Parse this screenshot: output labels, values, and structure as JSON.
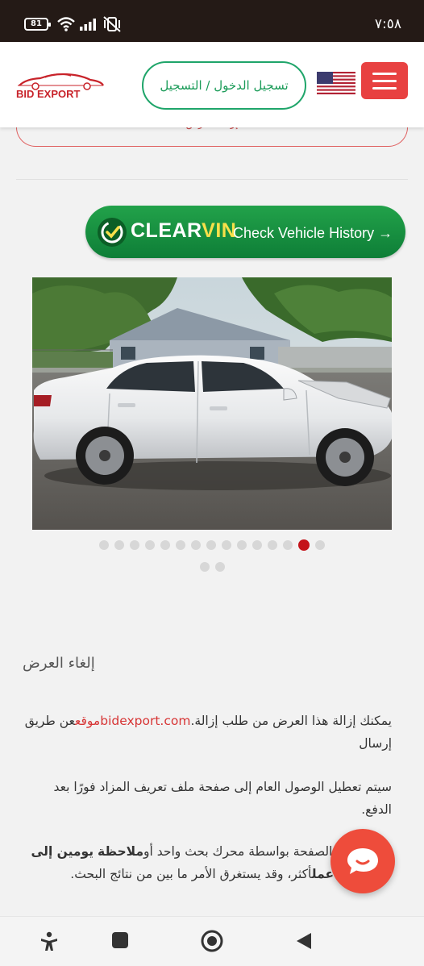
{
  "status_bar": {
    "battery": "81",
    "time": "٧:٥٨"
  },
  "header": {
    "logo_text": "BID EXPORT",
    "login_label": "تسجيل الدخول / التسجيل",
    "flag_icon": "us-flag-icon",
    "menu_icon": "hamburger-menu-icon",
    "accent_color": "#e84141",
    "login_color": "#1fa56a"
  },
  "remove_pill": {
    "label": "إزالة العرض"
  },
  "clearvin": {
    "brand_clear": "CLEAR",
    "brand_vin": "VIN",
    "cta": "Check Vehicle History →",
    "color": "#17913f"
  },
  "gallery": {
    "image_description": "white sedan parked on gravel lot",
    "total_dots": 16,
    "active_index": 13,
    "dot_color": "#d7d7d7",
    "active_color": "#c4141a"
  },
  "content": {
    "heading": "إلغاء العرض",
    "p1_before": "عن طريق إرسال",
    "p1_site_label": "موقع",
    "p1_link": "bidexport.com",
    "p1_after": "يمكنك إزالة هذا العرض من طلب إزالة.",
    "p2": "سيتم تعطيل الوصول العام إلى صفحة ملف تعريف المزاد فورًا بعد الدفع.",
    "p3_a": "تتم فهرسة الصفحة بواسطة محرك بحث واحد أو",
    "p3_b": "ملاحظة",
    "p3_c": "يومين إلى ثلاثة أيام عمل",
    "p3_d": "أكثر، وقد يستغرق الأمر ما بين من نتائج البحث."
  },
  "chat": {
    "icon": "chat-bubble-icon",
    "color": "#ee4c3b"
  },
  "nav": {
    "items": [
      "accessibility-icon",
      "recents-icon",
      "home-icon",
      "back-icon"
    ]
  }
}
